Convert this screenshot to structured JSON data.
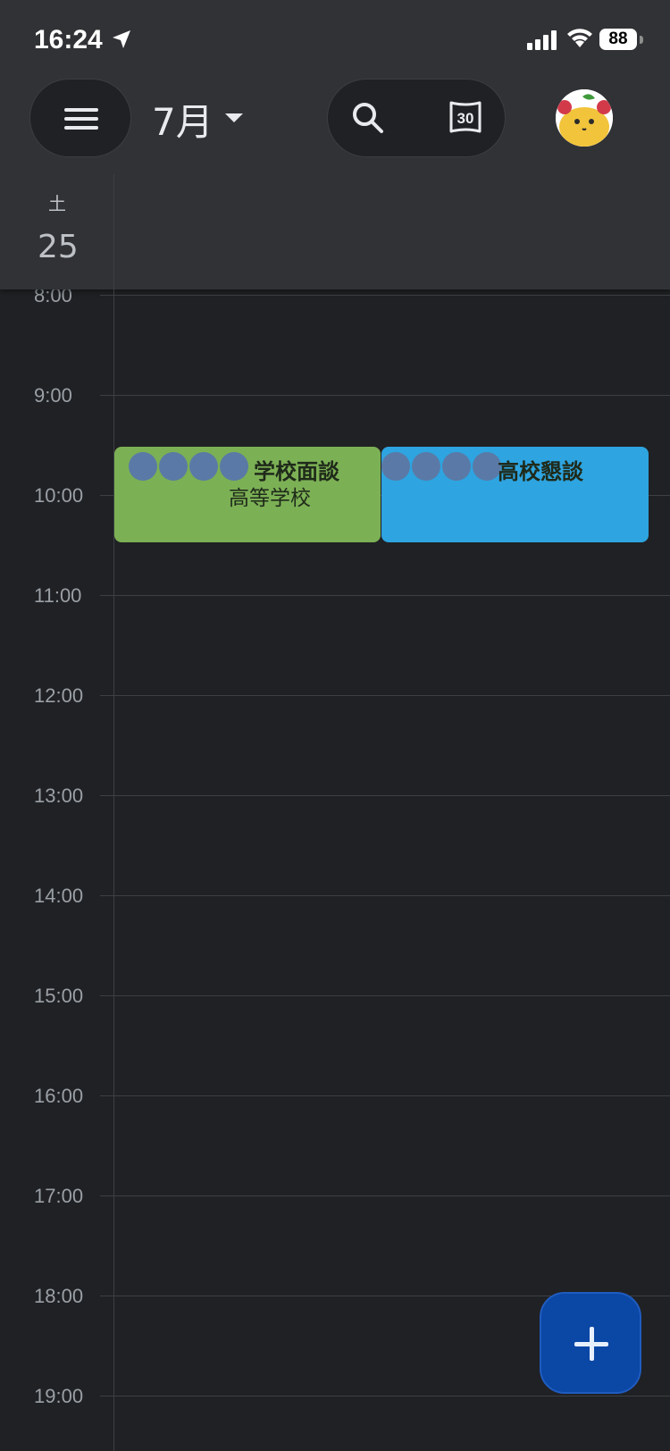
{
  "status_bar": {
    "time": "16:24",
    "battery": "88"
  },
  "toolbar": {
    "month": "7月"
  },
  "icons": {
    "menu": "hamburger-menu-icon",
    "search": "search-icon",
    "today": "calendar-today-icon",
    "today_number": "30",
    "avatar": "profile-avatar"
  },
  "day": {
    "weekday": "土",
    "date": "25"
  },
  "hours": [
    "8:00",
    "9:00",
    "10:00",
    "11:00",
    "12:00",
    "13:00",
    "14:00",
    "15:00",
    "16:00",
    "17:00",
    "18:00",
    "19:00"
  ],
  "events": [
    {
      "title": "学校面談",
      "subtitle": "高等学校",
      "color": "#7cb055"
    },
    {
      "title": "高校懇談",
      "color": "#2ea4e0"
    }
  ],
  "fab": {
    "icon": "plus-icon",
    "color": "#0b47a5"
  },
  "colors": {
    "background": "#202124",
    "header": "#313236"
  }
}
